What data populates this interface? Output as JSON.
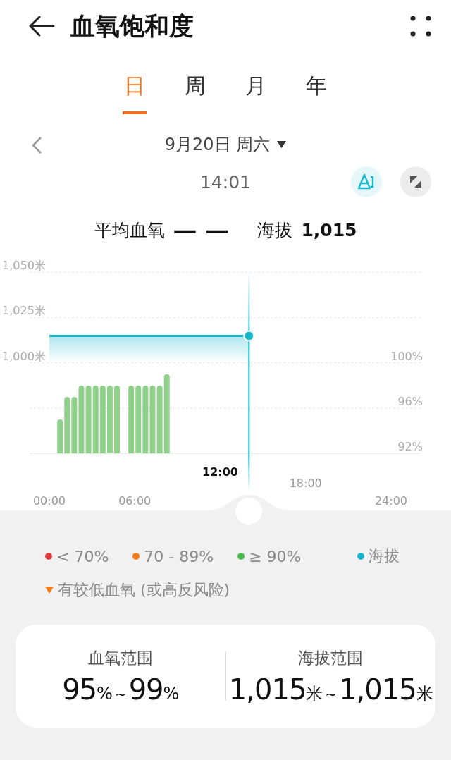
{
  "header": {
    "title": "血氧饱和度"
  },
  "tabs": [
    {
      "label": "日",
      "selected": true
    },
    {
      "label": "周",
      "selected": false
    },
    {
      "label": "月",
      "selected": false
    },
    {
      "label": "年",
      "selected": false
    }
  ],
  "date": {
    "label": "9月20日 周六"
  },
  "time": "14:01",
  "summary": [
    {
      "label": "平均血氧",
      "value": "— —"
    },
    {
      "label": "海拔",
      "value": "1,015"
    }
  ],
  "chart": {
    "chart_data": {
      "type": "bar",
      "x": [
        0.75,
        1.25,
        1.75,
        2.25,
        2.75,
        3.25,
        3.75,
        4.25,
        4.75,
        5.75,
        6.25,
        6.75,
        7.25,
        7.75,
        8.25
      ],
      "series": [
        {
          "color": "#8fd18a",
          "values": [
            95,
            97,
            97,
            98,
            98,
            98,
            98,
            98,
            98,
            98,
            98,
            98,
            98,
            98,
            99
          ]
        }
      ],
      "xlim": [
        0,
        24
      ],
      "ylim": [
        92,
        100
      ],
      "ref_lines": [
        {
          "axis": "x",
          "value": 14.02
        }
      ],
      "xticks": [
        {
          "value": 0,
          "label": "00:00"
        },
        {
          "value": 6,
          "label": "06:00"
        },
        {
          "value": 24,
          "label": "24:00"
        }
      ],
      "yticks": [
        {
          "value": 100,
          "label": "100%"
        },
        {
          "value": 96,
          "label": "96%"
        },
        {
          "value": 92,
          "label": "92%"
        }
      ]
    },
    "left_axis": [
      "1,050米",
      "1,025米",
      "1,000米"
    ],
    "raised_x_labels": [
      "12:00",
      "18:00"
    ]
  },
  "legend": [
    {
      "kind": "dot",
      "color": "#e0383e",
      "label": "< 70%"
    },
    {
      "kind": "dot",
      "color": "#f27b1c",
      "label": "70 - 89%"
    },
    {
      "kind": "dot",
      "color": "#4cbb4f",
      "label": "≥ 90%"
    },
    {
      "kind": "dot",
      "color": "#17b8cc",
      "label": "海拔"
    },
    {
      "kind": "triangle",
      "color": "#f27b1c",
      "label": "有较低血氧 (或高反风险)"
    }
  ],
  "ranges": [
    {
      "label": "血氧范围",
      "from": "95",
      "from_unit": "%",
      "sep": "~",
      "to": "99",
      "to_unit": "%"
    },
    {
      "label": "海拔范围",
      "from": "1,015",
      "from_unit": "米",
      "sep": "~",
      "to": "1,015",
      "to_unit": "米"
    }
  ]
}
